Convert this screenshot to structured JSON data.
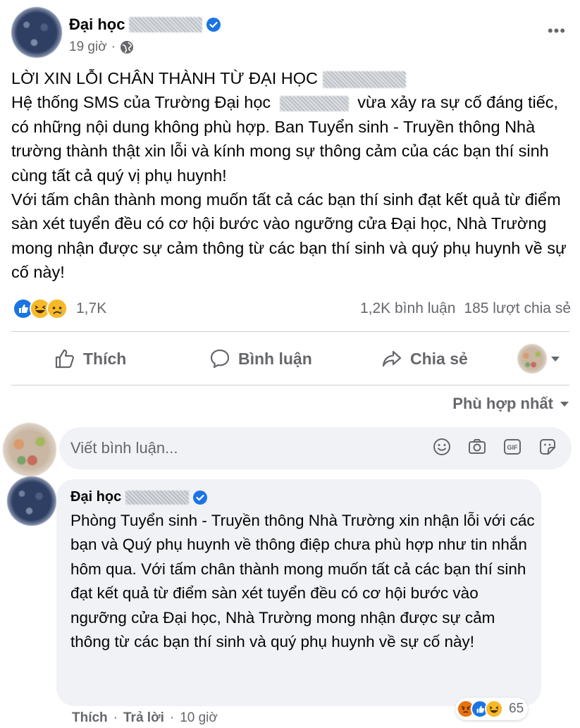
{
  "post": {
    "author": "Đại học",
    "time": "19 giờ",
    "separator": "·",
    "more_label": "•••",
    "body": [
      "LỜI XIN LỖI CHÂN THÀNH TỪ ĐẠI HỌC",
      "Hệ thống SMS của Trường Đại học",
      "vừa xảy ra sự cố đáng tiếc, có những nội dung không phù hợp. Ban Tuyển sinh - Truyền thông Nhà trường thành thật xin lỗi và kính mong sự thông cảm của các bạn thí sinh cùng tất cả quý vị phụ huynh!",
      "Với tấm chân thành mong muốn tất cả các bạn thí sinh đạt kết quả từ điểm sàn xét tuyển đều có cơ hội bước vào ngưỡng cửa Đại học, Nhà Trường mong nhận được sự cảm thông từ các bạn thí sinh và quý phụ huynh về sự cố này!"
    ],
    "reactions_count": "1,7K",
    "comments_count": "1,2K bình luận",
    "shares_count": "185 lượt chia sẻ",
    "reaction_icons": [
      "like-icon",
      "haha-icon",
      "sad-icon"
    ]
  },
  "actions": {
    "like": "Thích",
    "comment": "Bình luận",
    "share": "Chia sẻ"
  },
  "sort": {
    "label": "Phù hợp nhất"
  },
  "composer": {
    "placeholder": "Viết bình luận..."
  },
  "comment": {
    "author": "Đại học",
    "text": "Phòng Tuyển sinh - Truyền thông Nhà Trường xin nhận lỗi với các bạn và Quý phụ huynh về thông điệp chưa phù hợp như tin nhắn hôm qua. Với tấm chân thành mong muốn tất cả các bạn thí sinh đạt kết quả từ điểm sàn xét tuyển đều có cơ hội bước vào ngưỡng cửa Đại học, Nhà Trường mong nhận được sự cảm thông từ các bạn thí sinh và quý phụ huynh về sự cố này!",
    "reactions_count": "65",
    "reaction_icons": [
      "angry-icon",
      "like-icon",
      "haha-icon"
    ],
    "like_label": "Thích",
    "reply_label": "Trả lời",
    "separator": "·",
    "time": "10 giờ"
  },
  "colors": {
    "accent": "#1b74e4",
    "text_secondary": "#65676b",
    "bubble": "#f0f2f5",
    "divider": "#ced0d4"
  }
}
